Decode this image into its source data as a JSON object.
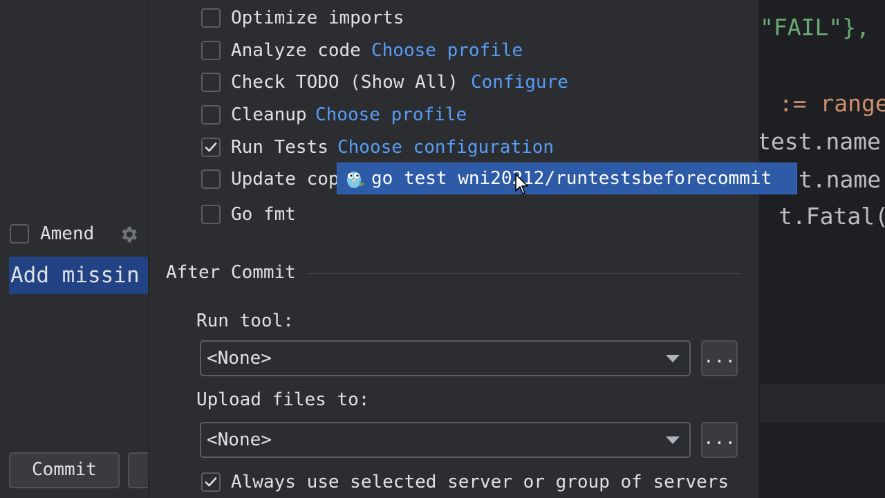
{
  "left_panel": {
    "amend_label": "Amend",
    "amend_checked": false,
    "commit_message": "Add missin",
    "commit_button": "Commit"
  },
  "editor": {
    "lines": [
      "\"FAIL\"},",
      ": := range",
      "test.name,",
      "st.name",
      "t.Fatal("
    ]
  },
  "before_commit": {
    "items": [
      {
        "label": "Optimize imports",
        "checked": false,
        "link": ""
      },
      {
        "label": "Analyze code",
        "checked": false,
        "link": "Choose profile"
      },
      {
        "label": "Check TODO (Show All)",
        "checked": false,
        "link": "Configure"
      },
      {
        "label": "Cleanup",
        "checked": false,
        "link": "Choose profile"
      },
      {
        "label": "Run Tests",
        "checked": true,
        "link": "Choose configuration"
      },
      {
        "label": "Update cop",
        "checked": false,
        "link": ""
      },
      {
        "label": "Go fmt",
        "checked": false,
        "link": ""
      }
    ]
  },
  "popup": {
    "icon": "gopher-icon",
    "item": "go test wni20212/runtestsbeforecommit"
  },
  "after_commit": {
    "title": "After Commit",
    "run_tool_label": "Run tool:",
    "run_tool_value": "<None>",
    "upload_label": "Upload files to:",
    "upload_value": "<None>",
    "browse_label": "...",
    "always_use_label": "Always use selected server or group of servers",
    "always_use_checked": true
  },
  "colors": {
    "link": "#589df6",
    "selection": "#2e5ba8",
    "commit_message_bg": "#214283"
  }
}
